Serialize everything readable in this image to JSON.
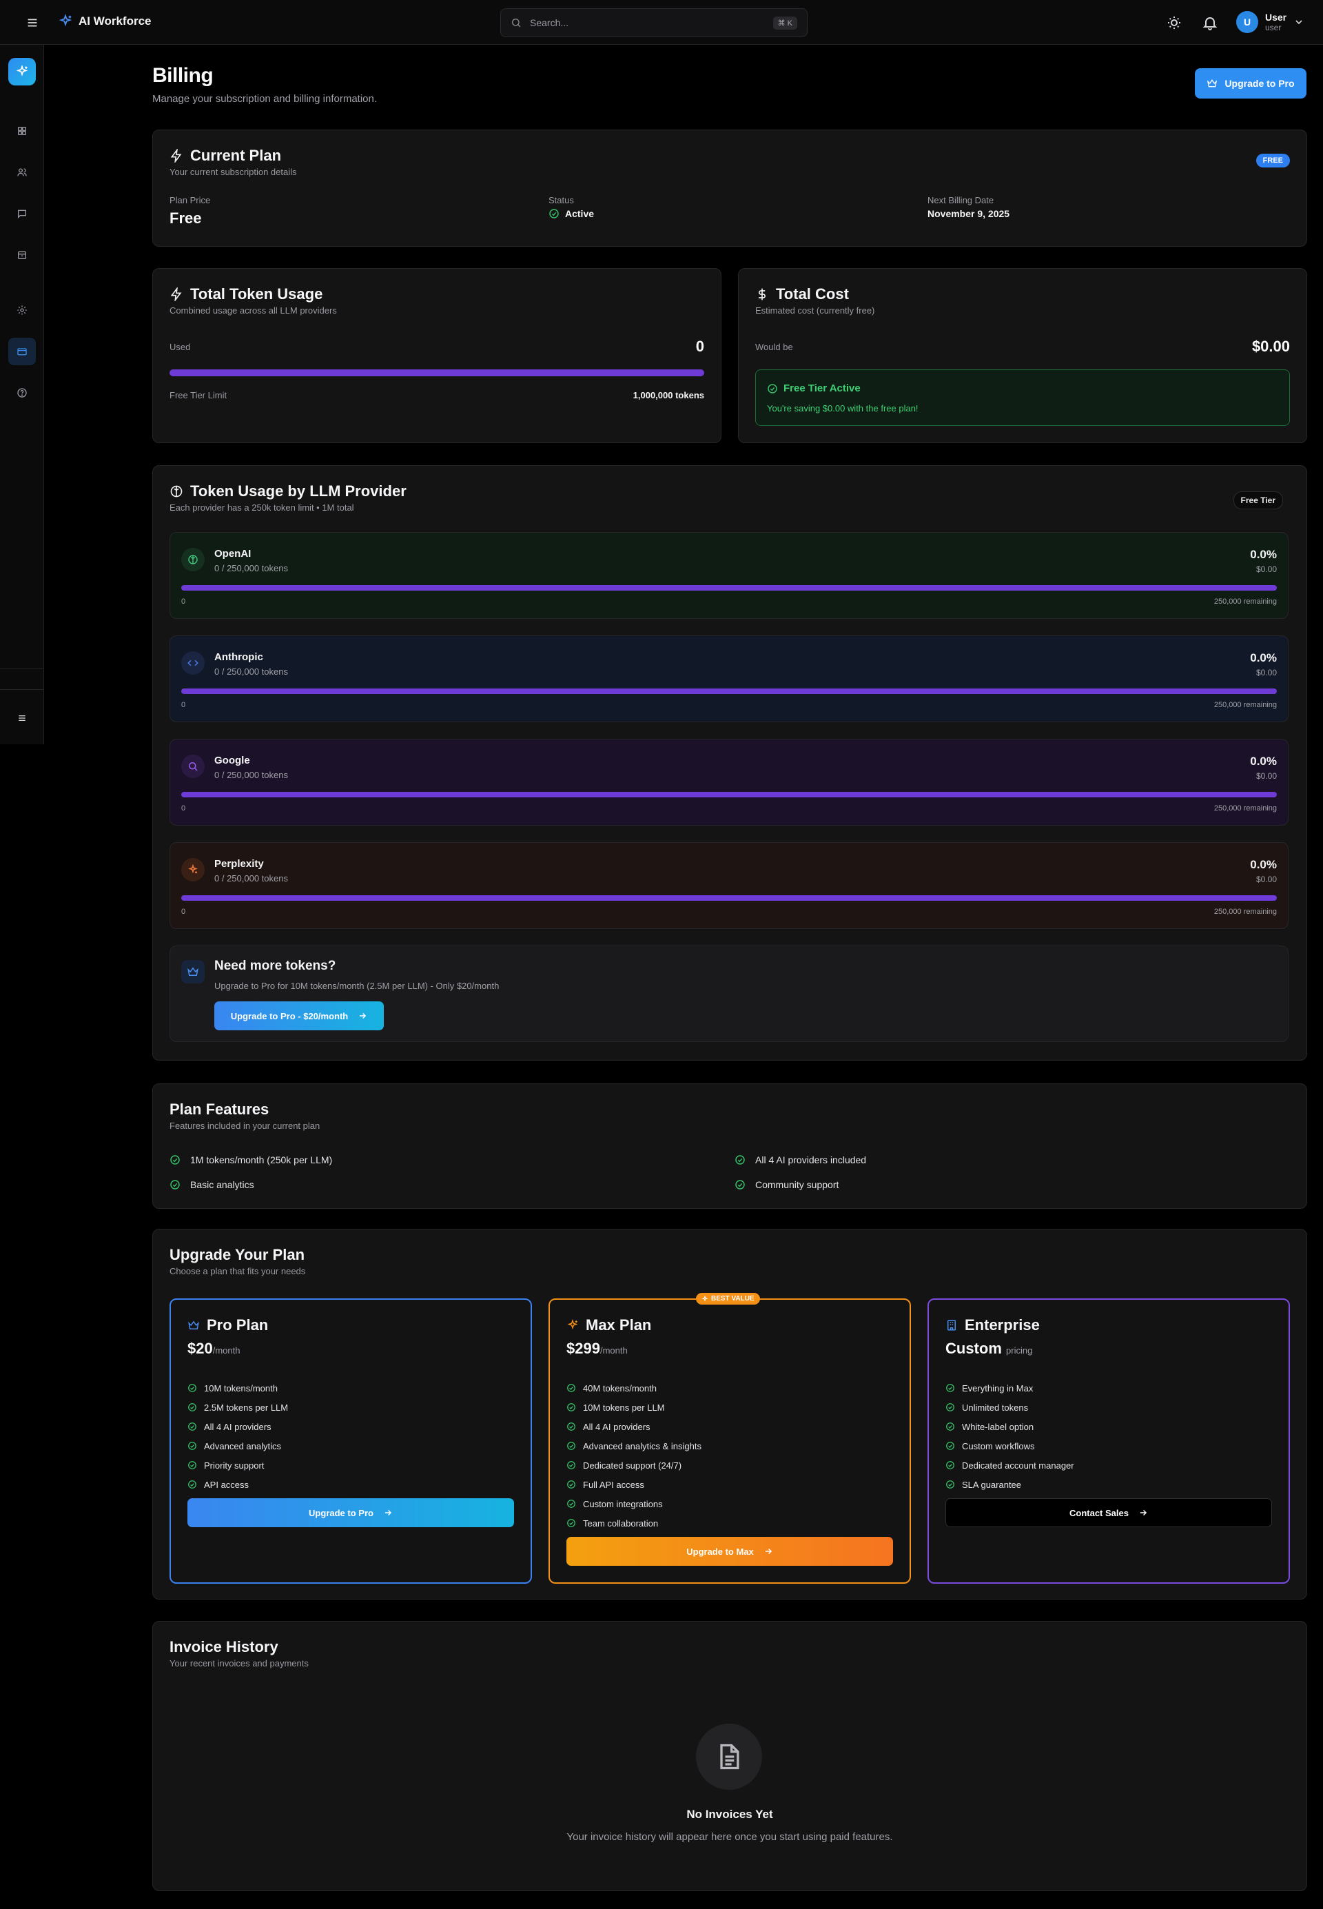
{
  "app": {
    "name": "AI Workforce"
  },
  "search": {
    "placeholder": "Search...",
    "shortcut": "⌘ K"
  },
  "user": {
    "initial": "U",
    "name": "User",
    "role": "user"
  },
  "page": {
    "title": "Billing",
    "subtitle": "Manage your subscription and billing information.",
    "upgrade_button": "Upgrade to Pro"
  },
  "current_plan": {
    "title": "Current Plan",
    "subtitle": "Your current subscription details",
    "badge": "FREE",
    "price_label": "Plan Price",
    "price_value": "Free",
    "status_label": "Status",
    "status_value": "Active",
    "billing_label": "Next Billing Date",
    "billing_value": "November 9, 2025"
  },
  "token_usage": {
    "title": "Total Token Usage",
    "subtitle": "Combined usage across all LLM providers",
    "used_label": "Used",
    "used_value": "0",
    "limit_label": "Free Tier Limit",
    "limit_value": "1,000,000 tokens",
    "fill_fraction": 0
  },
  "total_cost": {
    "title": "Total Cost",
    "subtitle": "Estimated cost (currently free)",
    "would_be_label": "Would be",
    "would_be_value": "$0.00",
    "free_tier_title": "Free Tier Active",
    "free_tier_text": "You're saving $0.00 with the free plan!"
  },
  "providers_card": {
    "title": "Token Usage by LLM Provider",
    "subtitle": "Each provider has a 250k token limit • 1M total",
    "badge": "Free Tier",
    "providers": [
      {
        "name": "OpenAI",
        "tokens": "0 / 250,000 tokens",
        "percent": "0.0%",
        "cost": "$0.00",
        "zero": "0",
        "remaining": "250,000 remaining",
        "icon": "openai-icon",
        "accent": "#3fbf7a"
      },
      {
        "name": "Anthropic",
        "tokens": "0 / 250,000 tokens",
        "percent": "0.0%",
        "cost": "$0.00",
        "zero": "0",
        "remaining": "250,000 remaining",
        "icon": "code-icon",
        "accent": "#4a7ee8"
      },
      {
        "name": "Google",
        "tokens": "0 / 250,000 tokens",
        "percent": "0.0%",
        "cost": "$0.00",
        "zero": "0",
        "remaining": "250,000 remaining",
        "icon": "search-icon",
        "accent": "#9b5cf0"
      },
      {
        "name": "Perplexity",
        "tokens": "0 / 250,000 tokens",
        "percent": "0.0%",
        "cost": "$0.00",
        "zero": "0",
        "remaining": "250,000 remaining",
        "icon": "sparkles-icon",
        "accent": "#ef7a3c"
      }
    ],
    "more_title": "Need more tokens?",
    "more_text": "Upgrade to Pro for 10M tokens/month (2.5M per LLM) - Only $20/month",
    "more_button": "Upgrade to Pro - $20/month"
  },
  "features": {
    "title": "Plan Features",
    "subtitle": "Features included in your current plan",
    "items": [
      "1M tokens/month (250k per LLM)",
      "All 4 AI providers included",
      "Basic analytics",
      "Community support"
    ]
  },
  "upgrade": {
    "title": "Upgrade Your Plan",
    "subtitle": "Choose a plan that fits your needs",
    "plans": [
      {
        "name": "Pro Plan",
        "price": "$20",
        "per": "/month",
        "features": [
          "10M tokens/month",
          "2.5M tokens per LLM",
          "All 4 AI providers",
          "Advanced analytics",
          "Priority support",
          "API access"
        ],
        "button": "Upgrade to Pro"
      },
      {
        "name": "Max Plan",
        "price": "$299",
        "per": "/month",
        "badge": "BEST VALUE",
        "features": [
          "40M tokens/month",
          "10M tokens per LLM",
          "All 4 AI providers",
          "Advanced analytics & insights",
          "Dedicated support (24/7)",
          "Full API access",
          "Custom integrations",
          "Team collaboration"
        ],
        "button": "Upgrade to Max"
      },
      {
        "name": "Enterprise",
        "price": "Custom",
        "per": "pricing",
        "features": [
          "Everything in Max",
          "Unlimited tokens",
          "White-label option",
          "Custom workflows",
          "Dedicated account manager",
          "SLA guarantee"
        ],
        "button": "Contact Sales"
      }
    ]
  },
  "invoices": {
    "title": "Invoice History",
    "subtitle": "Your recent invoices and payments",
    "empty_title": "No Invoices Yet",
    "empty_text": "Your invoice history will appear here once you start using paid features."
  },
  "colors": {
    "accent": "#2e8ef2",
    "progress": "#6e3bd6",
    "success": "#35c46a",
    "max_accent": "#f39016",
    "enterprise_accent": "#7b4be0"
  }
}
